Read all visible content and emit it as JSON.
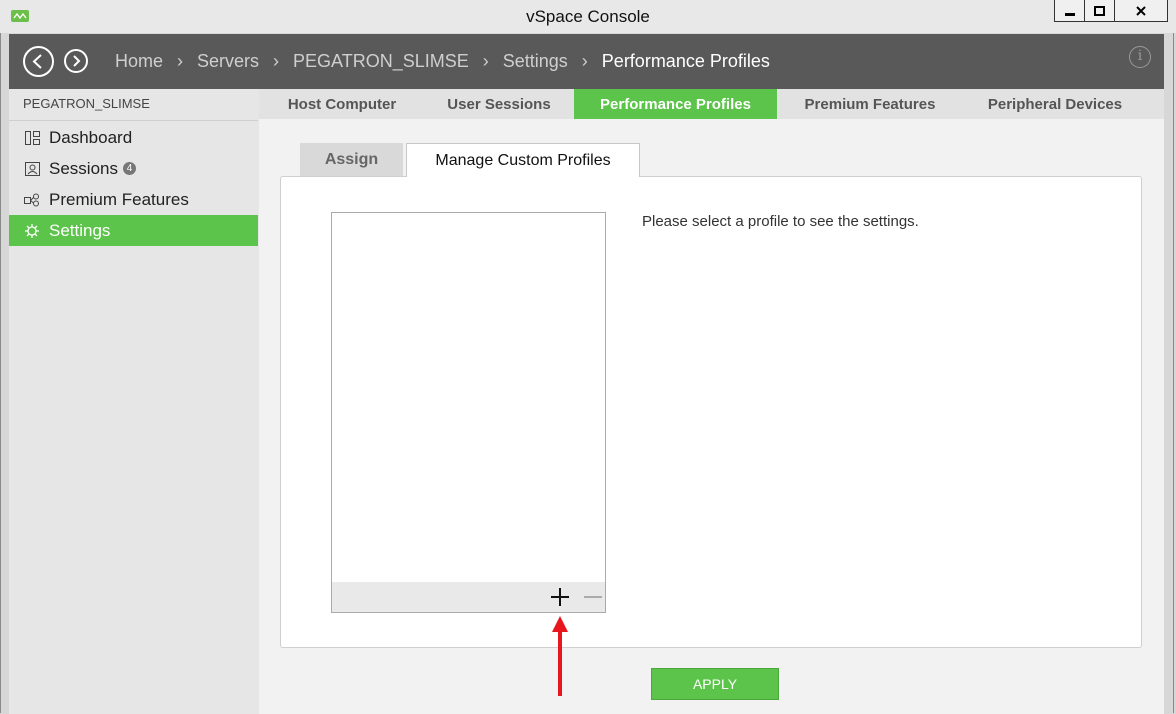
{
  "window": {
    "title": "vSpace Console"
  },
  "nav": {
    "breadcrumbs": [
      "Home",
      "Servers",
      "PEGATRON_SLIMSE",
      "Settings",
      "Performance Profiles"
    ],
    "separator": "›"
  },
  "sidebar": {
    "server_name": "PEGATRON_SLIMSE",
    "items": [
      {
        "label": "Dashboard",
        "icon": "dashboard-icon"
      },
      {
        "label": "Sessions",
        "icon": "sessions-icon",
        "badge": "4"
      },
      {
        "label": "Premium Features",
        "icon": "premium-icon"
      },
      {
        "label": "Settings",
        "icon": "settings-icon",
        "active": true
      }
    ]
  },
  "top_tabs": [
    "Host Computer",
    "User Sessions",
    "Performance Profiles",
    "Premium Features",
    "Peripheral Devices"
  ],
  "active_top_tab": "Performance Profiles",
  "sub_tabs": [
    "Assign",
    "Manage Custom Profiles"
  ],
  "active_sub_tab": "Manage Custom Profiles",
  "profiles_panel": {
    "hint": "Please select a profile to see the settings.",
    "add_icon": "plus-icon",
    "remove_icon": "minus-icon"
  },
  "apply_label": "APPLY",
  "colors": {
    "accent": "#5cc44a",
    "nav_bg": "#595959",
    "annotation_arrow": "#e8171d"
  }
}
